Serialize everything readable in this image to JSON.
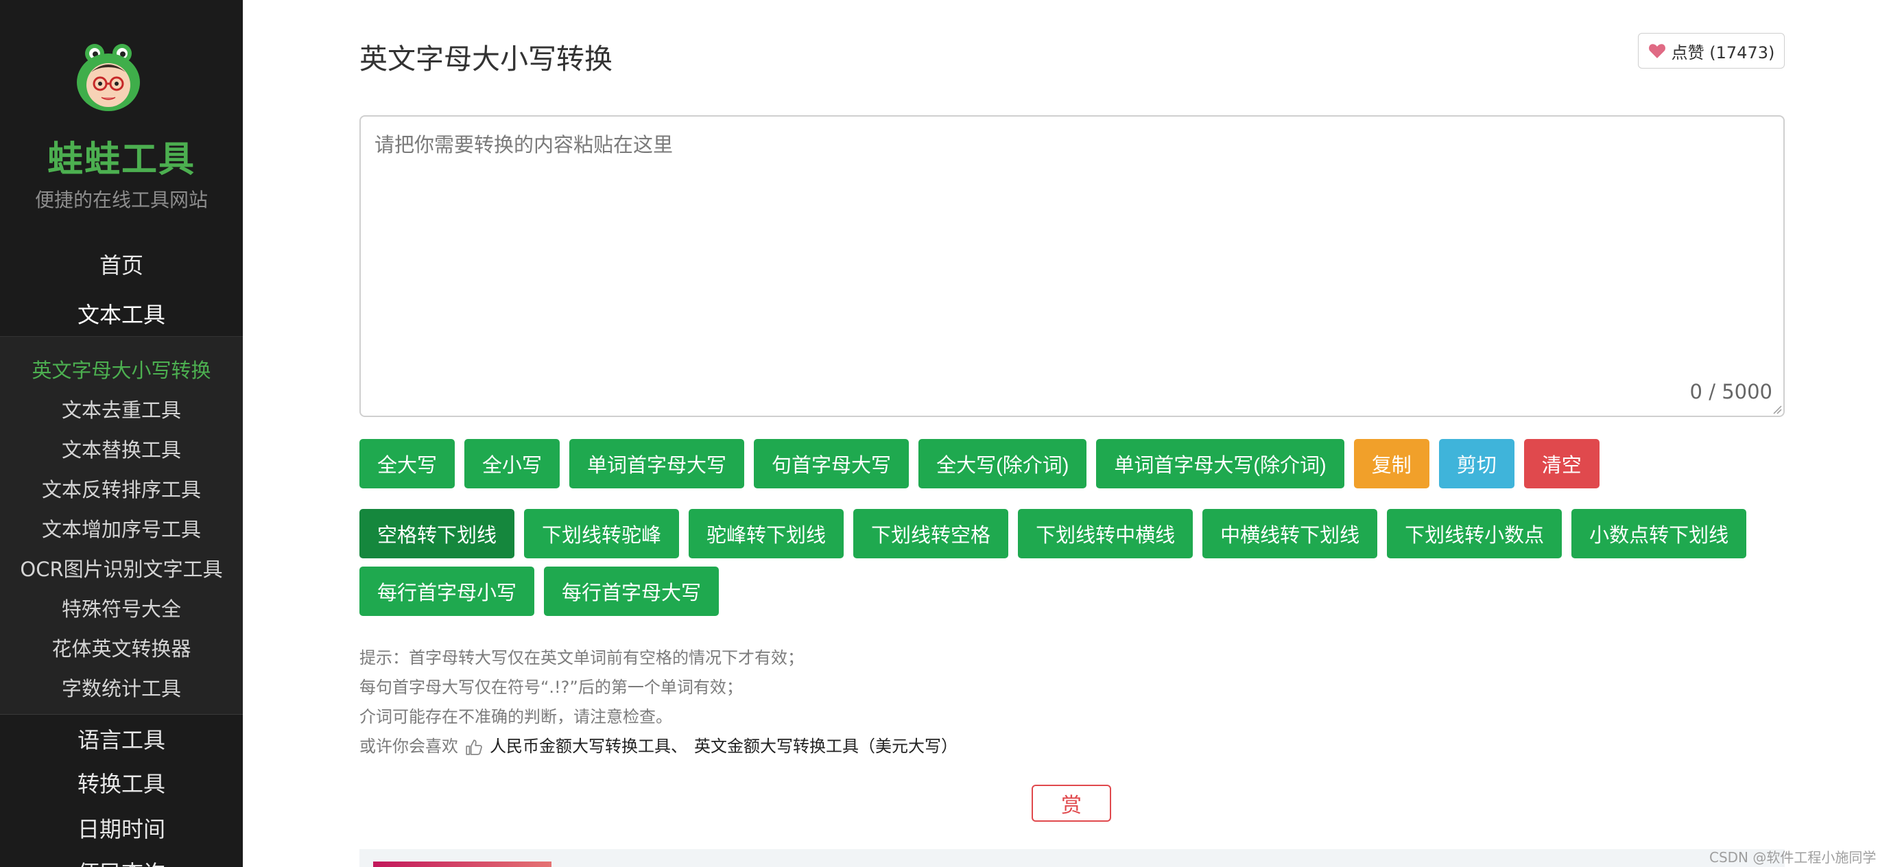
{
  "sidebar": {
    "brand": "蛙蛙工具",
    "tagline": "便捷的在线工具网站",
    "nav_top": [
      "首页",
      "文本工具"
    ],
    "submenu": [
      "英文字母大小写转换",
      "文本去重工具",
      "文本替换工具",
      "文本反转排序工具",
      "文本增加序号工具",
      "OCR图片识别文字工具",
      "特殊符号大全",
      "花体英文转换器",
      "字数统计工具"
    ],
    "nav_bottom": [
      "语言工具",
      "转换工具",
      "日期时间",
      "便民查询"
    ]
  },
  "main": {
    "title": "英文字母大小写转换",
    "like_label": "点赞 (17473)",
    "textarea_placeholder": "请把你需要转换的内容粘贴在这里",
    "counter": "0 / 5000",
    "row1": [
      "全大写",
      "全小写",
      "单词首字母大写",
      "句首字母大写",
      "全大写(除介词)",
      "单词首字母大写(除介词)",
      "复制",
      "剪切",
      "清空"
    ],
    "row2": [
      "空格转下划线",
      "下划线转驼峰",
      "驼峰转下划线",
      "下划线转空格",
      "下划线转中横线",
      "中横线转下划线",
      "下划线转小数点",
      "小数点转下划线"
    ],
    "row3": [
      "每行首字母小写",
      "每行首字母大写"
    ],
    "tips": [
      "提示：首字母转大写仅在英文单词前有空格的情况下才有效；",
      "每句首字母大写仅在符号“.!?”后的第一个单词有效；",
      "介词可能存在不准确的判断，请注意检查。"
    ],
    "maybe_like": "或许你会喜欢",
    "links": [
      "人民币金额大写转换工具、",
      "英文金额大写转换工具（美元大写）"
    ],
    "reward": "赏",
    "watermark": "CSDN @软件工程小施同学"
  },
  "colors": {
    "sidebar_bg": "#1b1b1b",
    "brand_green": "#4caf50",
    "button_green": "#1fa94f",
    "button_orange": "#f1a02a",
    "button_blue": "#3fb4da",
    "button_red": "#e0494d"
  },
  "icons": [
    "frog-logo-icon",
    "heart-icon",
    "thumbs-up-icon",
    "resize-grip-icon"
  ]
}
